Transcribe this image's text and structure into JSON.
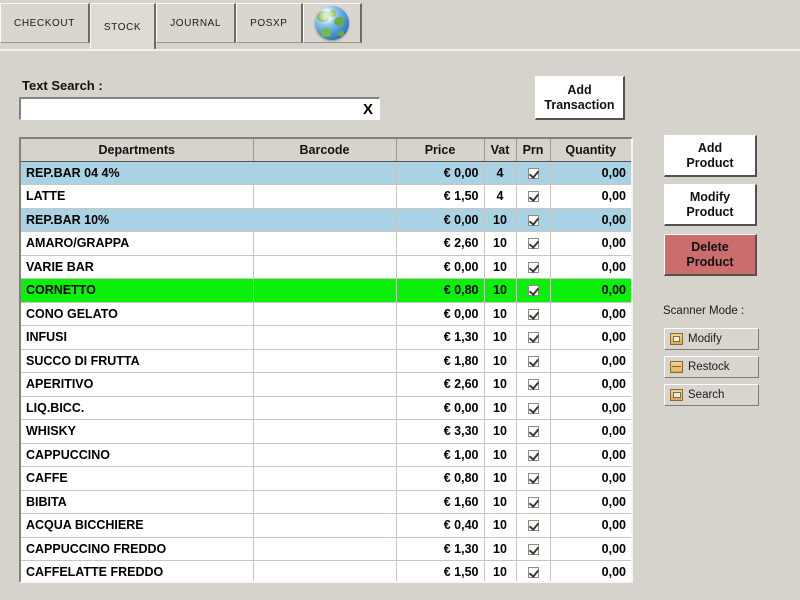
{
  "tabs": [
    {
      "label": "CHECKOUT",
      "selected": false,
      "kind": "text"
    },
    {
      "label": "STOCK",
      "selected": true,
      "kind": "text"
    },
    {
      "label": "JOURNAL",
      "selected": false,
      "kind": "text"
    },
    {
      "label": "POSXP",
      "selected": false,
      "kind": "text"
    },
    {
      "label": "",
      "selected": false,
      "kind": "globe",
      "icon": "globe-icon"
    }
  ],
  "search": {
    "label": "Text Search :",
    "value": "",
    "placeholder": "",
    "clear_label": "X"
  },
  "toolbar": {
    "add_transaction_line1": "Add",
    "add_transaction_line2": "Transaction"
  },
  "side_buttons": {
    "add_product_line1": "Add",
    "add_product_line2": "Product",
    "modify_product_line1": "Modify",
    "modify_product_line2": "Product",
    "delete_product_line1": "Delete",
    "delete_product_line2": "Product",
    "delete_color": "#cc6d6d"
  },
  "scanner_mode": {
    "label": "Scanner Mode :",
    "options": [
      {
        "label": "Modify",
        "icon": "modify-box-icon"
      },
      {
        "label": "Restock",
        "icon": "restock-box-icon"
      },
      {
        "label": "Search",
        "icon": "search-box-icon"
      }
    ]
  },
  "table": {
    "columns": [
      "Departments",
      "Barcode",
      "Price",
      "Vat",
      "Prn",
      "Quantity"
    ],
    "highlight_blue": "#a9d3e4",
    "highlight_green": "#0bf00b",
    "rows": [
      {
        "name": "REP.BAR 04 4%",
        "barcode": "",
        "price": "€ 0,00",
        "vat": "4",
        "prn": true,
        "qty": "0,00",
        "highlight": "blue"
      },
      {
        "name": "LATTE",
        "barcode": "",
        "price": "€ 1,50",
        "vat": "4",
        "prn": true,
        "qty": "0,00",
        "highlight": "none"
      },
      {
        "name": "REP.BAR 10%",
        "barcode": "",
        "price": "€ 0,00",
        "vat": "10",
        "prn": true,
        "qty": "0,00",
        "highlight": "blue"
      },
      {
        "name": "AMARO/GRAPPA",
        "barcode": "",
        "price": "€ 2,60",
        "vat": "10",
        "prn": true,
        "qty": "0,00",
        "highlight": "none"
      },
      {
        "name": "VARIE BAR",
        "barcode": "",
        "price": "€ 0,00",
        "vat": "10",
        "prn": true,
        "qty": "0,00",
        "highlight": "none"
      },
      {
        "name": "CORNETTO",
        "barcode": "",
        "price": "€ 0,80",
        "vat": "10",
        "prn": true,
        "qty": "0,00",
        "highlight": "green"
      },
      {
        "name": "CONO GELATO",
        "barcode": "",
        "price": "€ 0,00",
        "vat": "10",
        "prn": true,
        "qty": "0,00",
        "highlight": "none"
      },
      {
        "name": "INFUSI",
        "barcode": "",
        "price": "€ 1,30",
        "vat": "10",
        "prn": true,
        "qty": "0,00",
        "highlight": "none"
      },
      {
        "name": "SUCCO DI FRUTTA",
        "barcode": "",
        "price": "€ 1,80",
        "vat": "10",
        "prn": true,
        "qty": "0,00",
        "highlight": "none"
      },
      {
        "name": "APERITIVO",
        "barcode": "",
        "price": "€ 2,60",
        "vat": "10",
        "prn": true,
        "qty": "0,00",
        "highlight": "none"
      },
      {
        "name": "LIQ.BICC.",
        "barcode": "",
        "price": "€ 0,00",
        "vat": "10",
        "prn": true,
        "qty": "0,00",
        "highlight": "none"
      },
      {
        "name": "WHISKY",
        "barcode": "",
        "price": "€ 3,30",
        "vat": "10",
        "prn": true,
        "qty": "0,00",
        "highlight": "none"
      },
      {
        "name": "CAPPUCCINO",
        "barcode": "",
        "price": "€ 1,00",
        "vat": "10",
        "prn": true,
        "qty": "0,00",
        "highlight": "none"
      },
      {
        "name": "CAFFE",
        "barcode": "",
        "price": "€ 0,80",
        "vat": "10",
        "prn": true,
        "qty": "0,00",
        "highlight": "none"
      },
      {
        "name": "BIBITA",
        "barcode": "",
        "price": "€ 1,60",
        "vat": "10",
        "prn": true,
        "qty": "0,00",
        "highlight": "none"
      },
      {
        "name": "ACQUA BICCHIERE",
        "barcode": "",
        "price": "€ 0,40",
        "vat": "10",
        "prn": true,
        "qty": "0,00",
        "highlight": "none"
      },
      {
        "name": "CAPPUCCINO FREDDO",
        "barcode": "",
        "price": "€ 1,30",
        "vat": "10",
        "prn": true,
        "qty": "0,00",
        "highlight": "none"
      },
      {
        "name": "CAFFELATTE FREDDO",
        "barcode": "",
        "price": "€ 1,50",
        "vat": "10",
        "prn": true,
        "qty": "0,00",
        "highlight": "none"
      }
    ]
  }
}
